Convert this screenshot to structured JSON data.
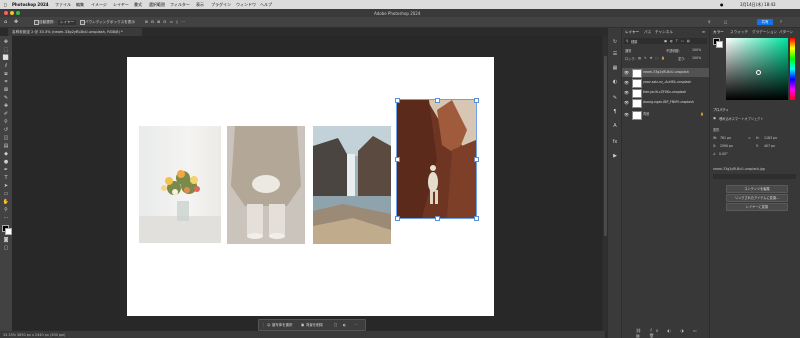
{
  "menubar": {
    "apple": "",
    "app": "Photoshop 2024",
    "items": [
      "ファイル",
      "編集",
      "イメージ",
      "レイヤー",
      "書式",
      "選択範囲",
      "フィルター",
      "表示",
      "プラグイン",
      "ウィンドウ",
      "ヘルプ"
    ],
    "clock": "3月14日(木) 18:43"
  },
  "window_title": "Adobe Photoshop 2024",
  "options": {
    "auto_select": "自動選択:",
    "layer_select": "レイヤー",
    "show_transform": "バウンディングボックスを表示",
    "share": "共有"
  },
  "doc_tab": "名称未設定 2 @ 33.3% (neom-33g2yRLBcU-unsplash, RGB/8) *",
  "context_bar": {
    "select_subject": "被写体を選択",
    "remove_bg": "背景を削除"
  },
  "status": "33.33%    3650 px x 2440 px (300 ppi)",
  "layers_panel": {
    "tabs": [
      "レイヤー",
      "パス",
      "チャンネル"
    ],
    "kind_label": "種類",
    "blend_mode": "通常",
    "opacity_label": "不透明度:",
    "opacity_value": "100%",
    "lock_label": "ロック:",
    "fill_label": "塗り:",
    "fill_value": "100%",
    "layers": [
      {
        "name": "neom-33g2yRLBcU-unsplash"
      },
      {
        "name": "yoav-aziz-xz_-AuHEk-unsplash"
      },
      {
        "name": "tide-jaclit-cZFXKz-unsplash"
      },
      {
        "name": "duong-ngan-IBP_FNMY-unsplash"
      },
      {
        "name": "背景"
      }
    ]
  },
  "color_panel": {
    "tabs": [
      "カラー",
      "スウォッチ",
      "グラデーション",
      "パターン"
    ]
  },
  "properties_panel": {
    "title": "プロパティ",
    "object_type": "埋め込みスマートオブジェクト",
    "transform_label": "変形",
    "w_label": "W:",
    "w_value": "781 px",
    "h_label": "H:",
    "h_value": "1183 px",
    "x_label": "X:",
    "x_value": "2590 px",
    "y_label": "Y:",
    "y_value": "407 px",
    "angle": "0.00°",
    "filename": "neom-33g2yRLBcU-unsplash.jpg",
    "buttons": [
      "コンテンツを編集",
      "リンクされたアイテムに変換...",
      "レイヤーに変換"
    ]
  }
}
